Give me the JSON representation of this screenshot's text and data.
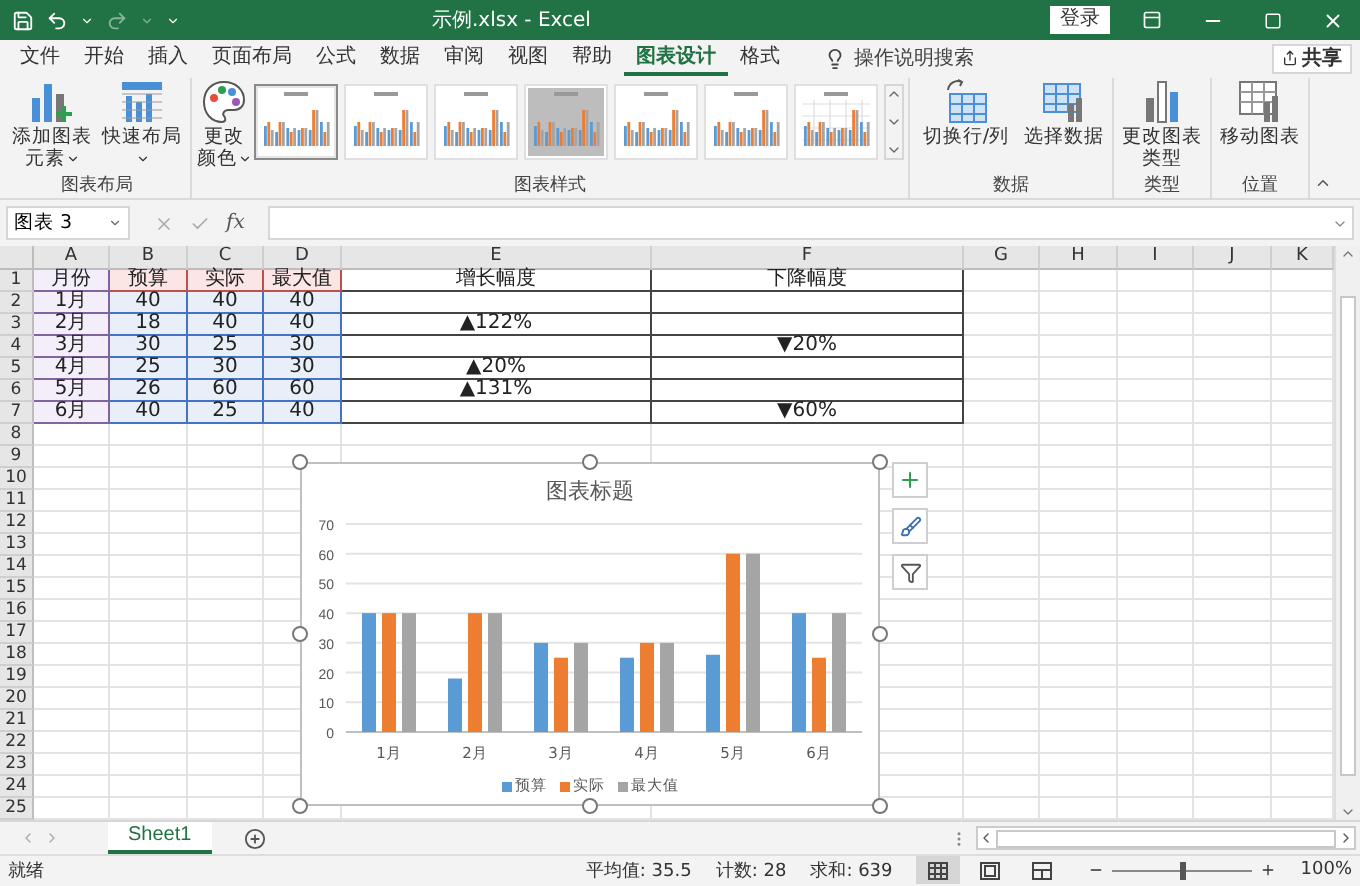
{
  "title_bar": {
    "title": "示例.xlsx  -  Excel",
    "sign_in": "登录"
  },
  "ribbon_tabs": [
    {
      "label": "文件",
      "selected": false
    },
    {
      "label": "开始",
      "selected": false
    },
    {
      "label": "插入",
      "selected": false
    },
    {
      "label": "页面布局",
      "selected": false
    },
    {
      "label": "公式",
      "selected": false
    },
    {
      "label": "数据",
      "selected": false
    },
    {
      "label": "审阅",
      "selected": false
    },
    {
      "label": "视图",
      "selected": false
    },
    {
      "label": "帮助",
      "selected": false
    },
    {
      "label": "图表设计",
      "selected": true
    },
    {
      "label": "格式",
      "selected": false
    }
  ],
  "tell_me": {
    "label": "操作说明搜索"
  },
  "share": {
    "label": "共享"
  },
  "ribbon_groups": [
    {
      "label": "图表布局",
      "buttons": [
        {
          "label": "添加图表元素",
          "dropdown": true
        },
        {
          "label": "快速布局",
          "dropdown": true
        }
      ]
    },
    {
      "label": "图表样式",
      "buttons": [
        {
          "label": "更改颜色",
          "dropdown": true
        }
      ],
      "styles": [
        {
          "kind": "plain",
          "selected": true
        },
        {
          "kind": "plain",
          "selected": false
        },
        {
          "kind": "plain",
          "selected": false
        },
        {
          "kind": "shaded",
          "selected": false
        },
        {
          "kind": "plain",
          "selected": false
        },
        {
          "kind": "plain",
          "selected": false
        },
        {
          "kind": "grid",
          "selected": false
        }
      ]
    },
    {
      "label": "数据",
      "buttons": [
        {
          "label": "切换行/列",
          "dropdown": false
        },
        {
          "label": "选择数据",
          "dropdown": false
        }
      ]
    },
    {
      "label": "类型",
      "buttons": [
        {
          "label": "更改图表类型",
          "dropdown": false
        }
      ]
    },
    {
      "label": "位置",
      "buttons": [
        {
          "label": "移动图表",
          "dropdown": false
        }
      ]
    }
  ],
  "formula_bar": {
    "name_box": "图表 3",
    "function_label": "fx"
  },
  "columns": [
    {
      "label": "A",
      "kind": "category"
    },
    {
      "label": "B",
      "kind": "series"
    },
    {
      "label": "C",
      "kind": "series"
    },
    {
      "label": "D",
      "kind": "series"
    },
    {
      "label": "E",
      "kind": "boxed"
    },
    {
      "label": "F",
      "kind": "boxed"
    },
    {
      "label": "G",
      "kind": "plain"
    },
    {
      "label": "H",
      "kind": "plain"
    },
    {
      "label": "I",
      "kind": "plain"
    },
    {
      "label": "J",
      "kind": "plain"
    },
    {
      "label": "K",
      "kind": "plain"
    }
  ],
  "rows": [
    {
      "number": "1",
      "cells": {
        "A": "月份",
        "B": "预算",
        "C": "实际",
        "D": "最大值",
        "E": "增长幅度",
        "F": "下降幅度"
      }
    },
    {
      "number": "2",
      "cells": {
        "A": "1月",
        "B": "40",
        "C": "40",
        "D": "40"
      }
    },
    {
      "number": "3",
      "cells": {
        "A": "2月",
        "B": "18",
        "C": "40",
        "D": "40",
        "E": "▲122%"
      }
    },
    {
      "number": "4",
      "cells": {
        "A": "3月",
        "B": "30",
        "C": "25",
        "D": "30",
        "F": "▼20%"
      }
    },
    {
      "number": "5",
      "cells": {
        "A": "4月",
        "B": "25",
        "C": "30",
        "D": "30",
        "E": "▲20%"
      }
    },
    {
      "number": "6",
      "cells": {
        "A": "5月",
        "B": "26",
        "C": "60",
        "D": "60",
        "E": "▲131%"
      }
    },
    {
      "number": "7",
      "cells": {
        "A": "6月",
        "B": "40",
        "C": "25",
        "D": "40",
        "F": "▼60%"
      }
    },
    {
      "number": "8"
    },
    {
      "number": "9"
    },
    {
      "number": "10"
    },
    {
      "number": "11"
    },
    {
      "number": "12"
    },
    {
      "number": "13"
    },
    {
      "number": "14"
    },
    {
      "number": "15"
    },
    {
      "number": "16"
    },
    {
      "number": "17"
    },
    {
      "number": "18"
    },
    {
      "number": "19"
    },
    {
      "number": "20"
    },
    {
      "number": "21"
    },
    {
      "number": "22"
    },
    {
      "number": "23"
    },
    {
      "number": "24"
    },
    {
      "number": "25"
    }
  ],
  "chart": {
    "chart_data": {
      "type": "bar",
      "title": "图表标题",
      "grid": true,
      "categories": [
        "1月",
        "2月",
        "3月",
        "4月",
        "5月",
        "6月"
      ],
      "series": [
        {
          "name": "预算",
          "color": "#5b9bd5",
          "values": [
            40,
            18,
            30,
            25,
            26,
            40
          ]
        },
        {
          "name": "实际",
          "color": "#ed7d31",
          "values": [
            40,
            40,
            25,
            30,
            60,
            25
          ]
        },
        {
          "name": "最大值",
          "color": "#a5a5a5",
          "values": [
            40,
            40,
            30,
            30,
            60,
            40
          ]
        }
      ],
      "ylim": [
        0,
        70
      ],
      "yticks": [
        {
          "value": 0,
          "label": "0"
        },
        {
          "value": 10,
          "label": "10"
        },
        {
          "value": 20,
          "label": "20"
        },
        {
          "value": 30,
          "label": "30"
        },
        {
          "value": 40,
          "label": "40"
        },
        {
          "value": 50,
          "label": "50"
        },
        {
          "value": 60,
          "label": "60"
        },
        {
          "value": 70,
          "label": "70"
        }
      ]
    }
  },
  "sheet_tabs": [
    {
      "label": "Sheet1",
      "selected": true
    }
  ],
  "status_bar": {
    "ready": "就绪",
    "average": "平均值: 35.5",
    "count": "计数: 28",
    "sum": "求和: 639",
    "views": [
      {
        "kind": "normal",
        "selected": true
      },
      {
        "kind": "page-layout",
        "selected": false
      },
      {
        "kind": "page-break",
        "selected": false
      }
    ],
    "zoom": {
      "level": 0.5,
      "reading": "100%"
    }
  }
}
